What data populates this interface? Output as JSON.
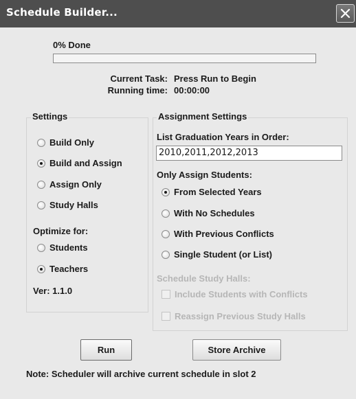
{
  "window": {
    "title": "Schedule Builder..."
  },
  "progress": {
    "label": "0% Done",
    "fraction": 0.0
  },
  "status": {
    "current_task_label": "Current Task:",
    "current_task_value": "Press Run to Begin",
    "running_time_label": "Running time:",
    "running_time_value": "00:00:00"
  },
  "settings": {
    "heading": "Settings",
    "mode_options": [
      {
        "label": "Build Only",
        "selected": false
      },
      {
        "label": "Build and Assign",
        "selected": true
      },
      {
        "label": "Assign Only",
        "selected": false
      },
      {
        "label": "Study Halls",
        "selected": false
      }
    ],
    "optimize_heading": "Optimize for:",
    "optimize_options": [
      {
        "label": "Students",
        "selected": false
      },
      {
        "label": "Teachers",
        "selected": true
      }
    ],
    "version": "Ver: 1.1.0"
  },
  "assignment": {
    "heading": "Assignment Settings",
    "grad_years_label": "List Graduation Years in Order:",
    "grad_years_value": "2010,2011,2012,2013",
    "only_assign_label": "Only Assign Students:",
    "assign_options": [
      {
        "label": "From Selected Years",
        "selected": true
      },
      {
        "label": "With No Schedules",
        "selected": false
      },
      {
        "label": "With Previous Conflicts",
        "selected": false
      },
      {
        "label": "Single Student (or List)",
        "selected": false
      }
    ],
    "study_halls_label": "Schedule Study Halls:",
    "study_hall_checks": [
      {
        "label": "Include Students with Conflicts",
        "checked": false,
        "enabled": false
      },
      {
        "label": "Reassign Previous Study Halls",
        "checked": false,
        "enabled": false
      }
    ]
  },
  "buttons": {
    "run": "Run",
    "store_archive": "Store Archive"
  },
  "note": "Note: Scheduler will archive current schedule in slot 2",
  "colors": {
    "titlebar": "#4e4e4e",
    "window_bg": "#e9e9e9",
    "disabled_text": "#b6b6b6"
  }
}
